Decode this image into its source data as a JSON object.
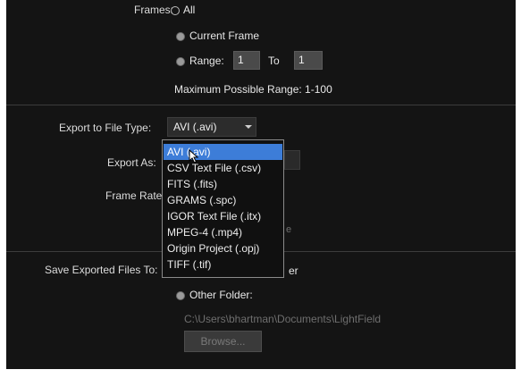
{
  "frames": {
    "label": "Frames:",
    "options": [
      {
        "label": "All",
        "selected": true
      },
      {
        "label": "Current Frame",
        "selected": false
      },
      {
        "label": "Range:",
        "selected": false
      }
    ],
    "range_from": "1",
    "range_to_label": "To",
    "range_to": "1",
    "max_range": "Maximum Possible Range: 1-100"
  },
  "export_type": {
    "label": "Export to File Type:",
    "value": "AVI (.avi)"
  },
  "export_as": {
    "label": "Export As:"
  },
  "frame_rate": {
    "label": "Frame Rate:"
  },
  "dropdown": {
    "items": [
      "AVI (.avi)",
      "CSV Text File (.csv)",
      "FITS (.fits)",
      "GRAMS (.spc)",
      "IGOR Text File (.itx)",
      "MPEG-4 (.mp4)",
      "Origin Project (.opj)",
      "TIFF (.tif)"
    ],
    "selected_index": 0
  },
  "save": {
    "label": "Save Exported Files To:",
    "partial_folder_text": "er",
    "other_folder_label": "Other Folder:",
    "path": "C:\\Users\\bhartman\\Documents\\LightField",
    "browse_label": "Browse..."
  },
  "colors": {
    "background": "#141414",
    "selection": "#3d7dd8"
  }
}
